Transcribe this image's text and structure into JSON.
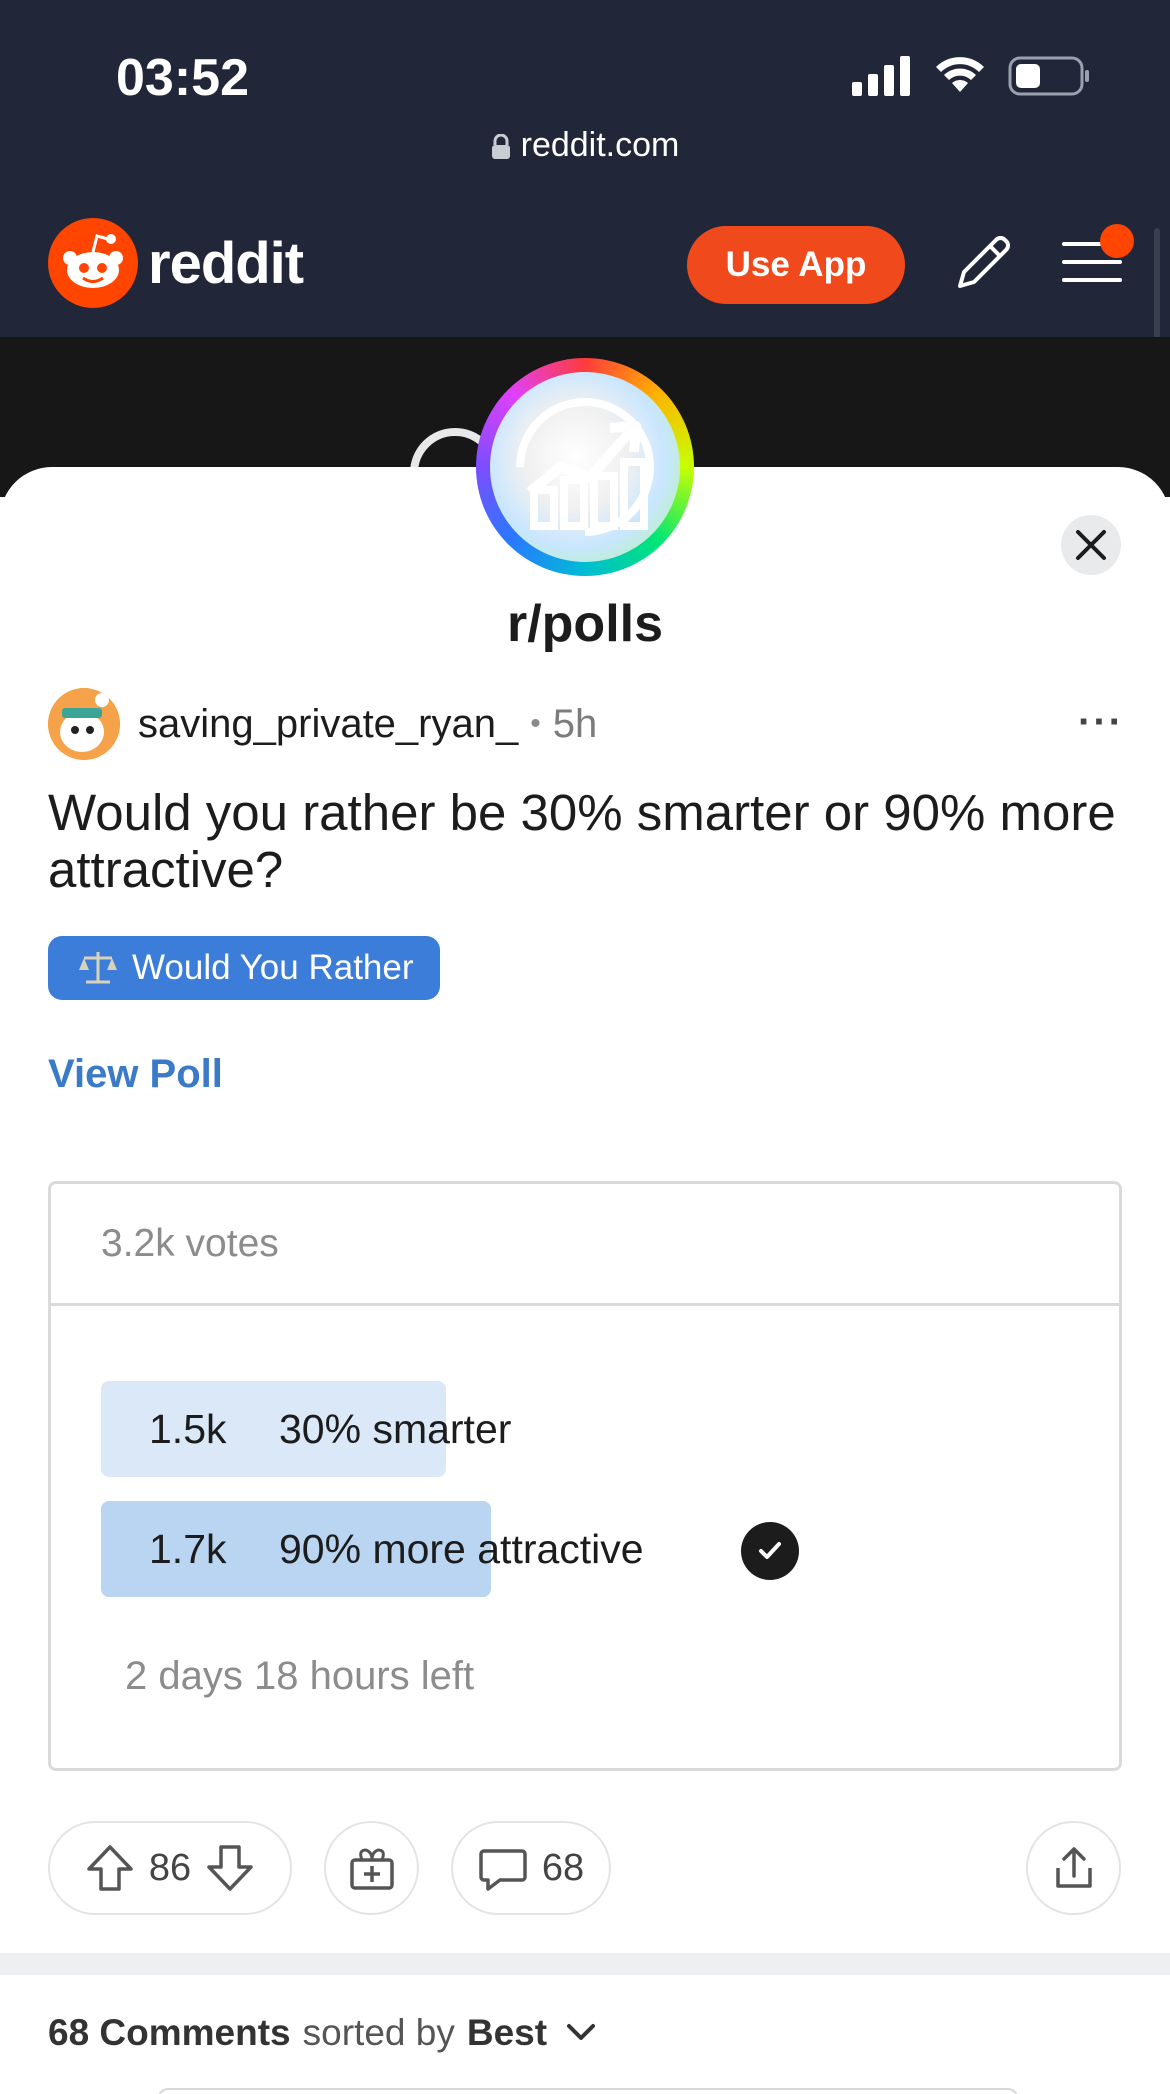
{
  "status_bar": {
    "time": "03:52"
  },
  "browser": {
    "url": "reddit.com"
  },
  "header": {
    "logo_text": "reddit",
    "use_app_label": "Use App"
  },
  "subreddit": {
    "name": "r/polls"
  },
  "post": {
    "author": "saving_private_ryan_",
    "separator": "•",
    "age": "5h",
    "more_label": "···",
    "title": "Would you rather be 30% smarter or 90% more attractive?",
    "flair": "Would You Rather",
    "view_poll_label": "View Poll"
  },
  "poll": {
    "total_votes": "3.2k votes",
    "options": [
      {
        "count": "1.5k",
        "label": "30% smarter",
        "share": 0.47,
        "selected": false
      },
      {
        "count": "1.7k",
        "label": "90% more attractive",
        "share": 0.53,
        "selected": true
      }
    ],
    "time_left": "2 days 18 hours left"
  },
  "actions": {
    "score": "86",
    "comments_count": "68"
  },
  "comments_bar": {
    "count_label": "68 Comments",
    "sorted_by": "sorted by",
    "sort_value": "Best"
  },
  "colors": {
    "brand": "#ff4500",
    "use_app": "#f04a1c",
    "flair": "#3b7dd8",
    "link": "#3a7ac6",
    "poll_option": "#dbe8f7",
    "poll_option_winner": "#b9d5f1"
  }
}
